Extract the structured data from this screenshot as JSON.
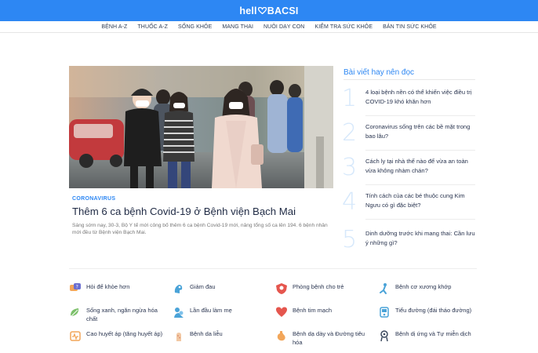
{
  "brand": {
    "logo_text_left": "hell",
    "logo_text_right": "BACSI"
  },
  "nav": {
    "items": [
      "BỆNH A-Z",
      "THUỐC A-Z",
      "SỐNG KHỎE",
      "MANG THAI",
      "NUÔI DẠY CON",
      "KIỂM TRA SỨC KHỎE",
      "BẢN TIN SỨC KHỎE"
    ]
  },
  "featured": {
    "category": "CORONAVIRUS",
    "title": "Thêm 6 ca bệnh Covid-19 ở Bệnh viện Bạch Mai",
    "summary": "Sáng sớm nay, 30-3, Bộ Y tế mới công bố thêm 6 ca bệnh Covid-19 mới, nâng tổng số ca lên 194. 6 bệnh nhân mới đều từ Bệnh viện Bạch Mai."
  },
  "sidebar": {
    "title": "Bài viết hay nên đọc",
    "items": [
      {
        "num": "1",
        "text": "4 loại bệnh nền có thể khiến việc điều trị COVID-19 khó khăn hơn"
      },
      {
        "num": "2",
        "text": "Coronavirus sống trên các bề mặt trong bao lâu?"
      },
      {
        "num": "3",
        "text": "Cách ly tại nhà thế nào để vừa an toàn vừa không nhàm chán?"
      },
      {
        "num": "4",
        "text": "Tính cách của các bé thuộc cung Kim Ngưu có gì đặc biệt?"
      },
      {
        "num": "5",
        "text": "Dinh dưỡng trước khi mang thai: Cần lưu ý những gì?"
      }
    ]
  },
  "topics": [
    {
      "label": "Hỏi để khỏe hơn",
      "icon": "question-bubble-icon"
    },
    {
      "label": "Giảm đau",
      "icon": "pain-relief-icon"
    },
    {
      "label": "Phòng bệnh cho trẻ",
      "icon": "child-shield-icon"
    },
    {
      "label": "Bệnh cơ xương khớp",
      "icon": "bone-joint-icon"
    },
    {
      "label": "Sống xanh, ngăn ngừa hóa chất",
      "icon": "green-living-icon"
    },
    {
      "label": "Lần đầu làm mẹ",
      "icon": "mother-baby-icon"
    },
    {
      "label": "Bệnh tim mạch",
      "icon": "heart-icon"
    },
    {
      "label": "Tiểu đường (đái tháo đường)",
      "icon": "diabetes-icon"
    },
    {
      "label": "Cao huyết áp (tăng huyết áp)",
      "icon": "blood-pressure-icon"
    },
    {
      "label": "Bệnh da liễu",
      "icon": "skin-icon"
    },
    {
      "label": "Bệnh dạ dày và Đường tiêu hóa",
      "icon": "stomach-icon"
    },
    {
      "label": "Bệnh dị ứng và Tự miễn dịch",
      "icon": "allergy-icon"
    }
  ],
  "colors": {
    "brand_blue": "#2d87f3",
    "text_dark": "#1f2a44",
    "number_light": "#d6e8fb",
    "icon_orange": "#f2a65a",
    "icon_red": "#e5564e"
  }
}
